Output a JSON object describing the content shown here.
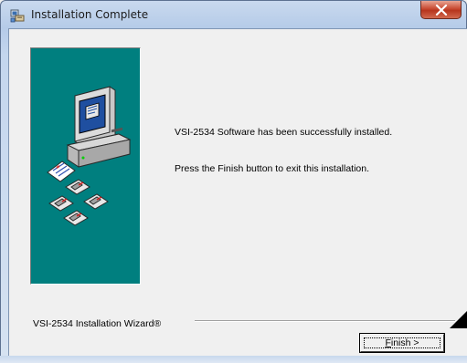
{
  "window": {
    "title": "Installation Complete",
    "icon": "installer-app-icon",
    "close_label": "x"
  },
  "content": {
    "message_installed": "VSI-2534 Software has been successfully installed.",
    "message_finish": "Press the Finish button to exit this installation.",
    "wizard_label": "VSI-2534 Installation Wizard®"
  },
  "buttons": {
    "finish_label_prefix": "F",
    "finish_label_rest": "inish >"
  },
  "colors": {
    "side_panel": "#007f7f",
    "dialog_bg": "#f0f0f0",
    "close_button": "#c94a32"
  },
  "illustration": "computer-with-floppy-disks-icon"
}
